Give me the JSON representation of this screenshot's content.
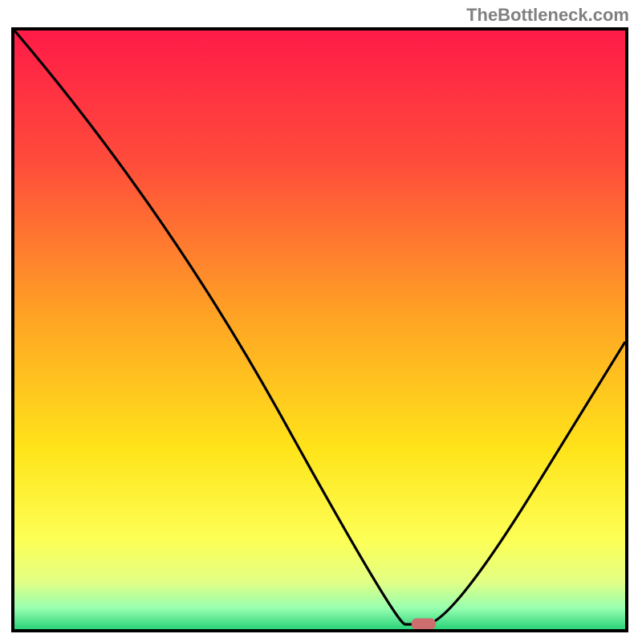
{
  "watermark": "TheBottleneck.com",
  "chart_data": {
    "type": "line",
    "title": "",
    "xlabel": "",
    "ylabel": "",
    "xlim": [
      0,
      100
    ],
    "ylim": [
      0,
      100
    ],
    "grid": false,
    "series": [
      {
        "name": "bottleneck-curve",
        "x": [
          0,
          25,
          63,
          67,
          71,
          100
        ],
        "y": [
          100,
          70,
          0,
          0,
          0,
          48
        ]
      }
    ],
    "marker": {
      "x": 67,
      "y": 0.6,
      "color": "#cd6d6d"
    },
    "gradient_stops": [
      {
        "pos": 0.0,
        "color": "#ff1b48"
      },
      {
        "pos": 0.22,
        "color": "#ff4c3b"
      },
      {
        "pos": 0.48,
        "color": "#ffa424"
      },
      {
        "pos": 0.7,
        "color": "#ffe41a"
      },
      {
        "pos": 0.85,
        "color": "#fdff55"
      },
      {
        "pos": 0.92,
        "color": "#e3ff84"
      },
      {
        "pos": 0.965,
        "color": "#97ffb0"
      },
      {
        "pos": 1.0,
        "color": "#2bd37a"
      }
    ]
  }
}
